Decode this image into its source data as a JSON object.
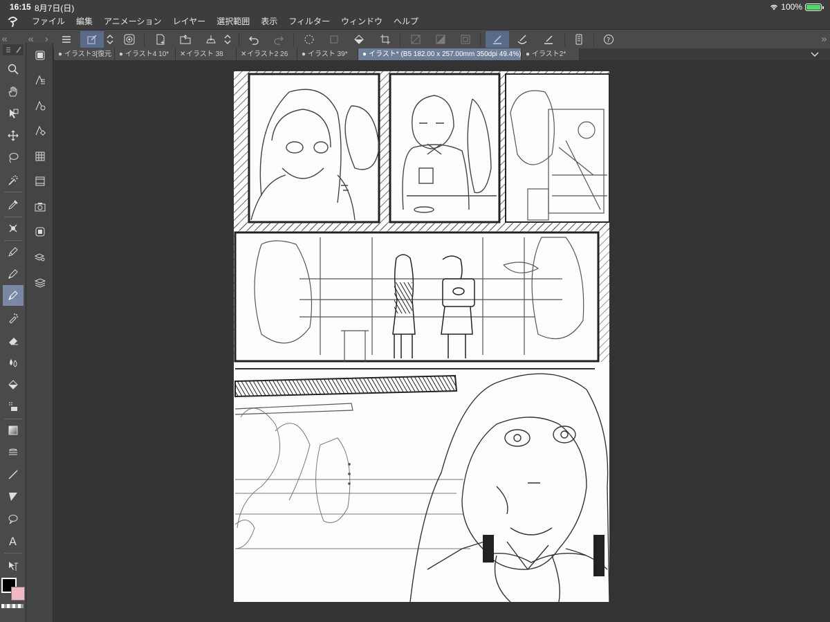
{
  "status": {
    "time": "16:15",
    "date": "8月7日(日)",
    "battery": "100%"
  },
  "menu": [
    "ファイル",
    "編集",
    "アニメーション",
    "レイヤー",
    "選択範囲",
    "表示",
    "フィルター",
    "ウィンドウ",
    "ヘルプ"
  ],
  "tabs": [
    {
      "label": "イラスト3[復元",
      "mark": "●"
    },
    {
      "label": "イラスト4 10*",
      "mark": "●"
    },
    {
      "label": "イラスト 38",
      "mark": "✕"
    },
    {
      "label": "イラスト2 26",
      "mark": "✕"
    },
    {
      "label": "イラスト 39*",
      "mark": "●"
    },
    {
      "label": "イラスト* (B5 182.00 x 257.00mm 350dpi 49.4%)",
      "mark": "●",
      "active": true
    },
    {
      "label": "イラスト2*",
      "mark": "●"
    }
  ],
  "colors": {
    "main": "#000000",
    "sub": "#f3b7c3",
    "accent": "#7a88a6"
  },
  "tools": [
    "zoom-icon",
    "hand-icon",
    "operation-icon",
    "move-icon",
    "lasso-select-icon",
    "magic-wand-icon",
    "eyedropper-icon",
    "blend-icon",
    "pen-icon",
    "pencil-icon",
    "brush-icon",
    "airbrush-icon",
    "eraser-icon",
    "fill-icon",
    "bucket-icon",
    "decoration-icon",
    "gradient-icon",
    "figure-icon",
    "line-icon",
    "frame-icon",
    "balloon-icon",
    "text-icon",
    "correct-line-icon"
  ],
  "subtools": [
    "panel-icon",
    "subtool-vector-a",
    "subtool-vector-b",
    "subtool-vector-c",
    "material-icon",
    "timeline-icon",
    "camera-icon",
    "layer-property-icon",
    "layer-search-icon",
    "layer-icon"
  ]
}
